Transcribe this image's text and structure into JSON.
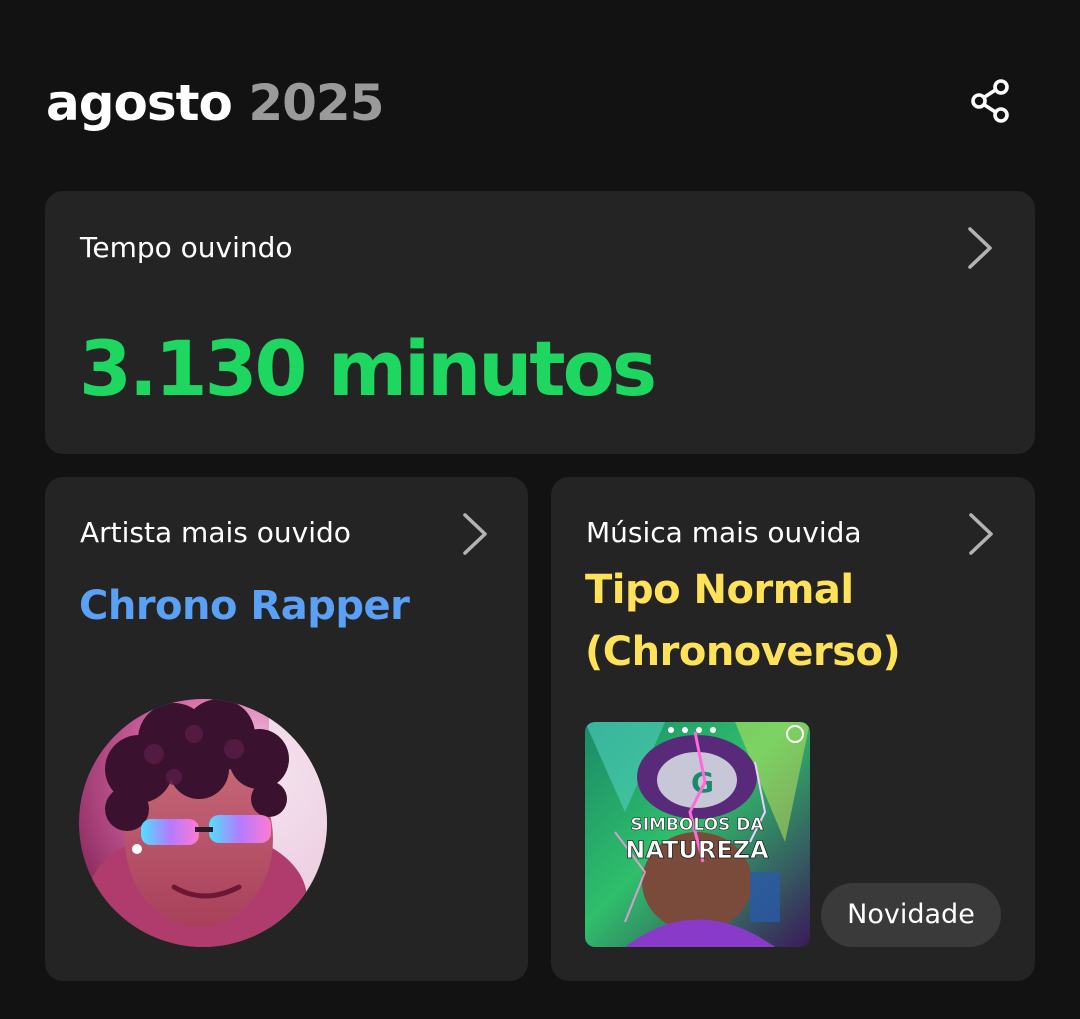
{
  "header": {
    "month": "agosto",
    "year": "2025",
    "share_icon": "share-icon"
  },
  "listening_time": {
    "label": "Tempo ouvindo",
    "value": "3.130 minutos",
    "accent": "#1ed760"
  },
  "top_artist": {
    "label": "Artista mais ouvido",
    "name": "Chrono Rapper",
    "accent": "#5aa0f5"
  },
  "top_song": {
    "label": "Música mais ouvida",
    "title": "Tipo Normal (Chronoverso)",
    "badge": "Novidade",
    "cover_text_line1": "SIMBOLOS DA",
    "cover_text_line2": "NATUREZA",
    "accent": "#ffe15a"
  }
}
